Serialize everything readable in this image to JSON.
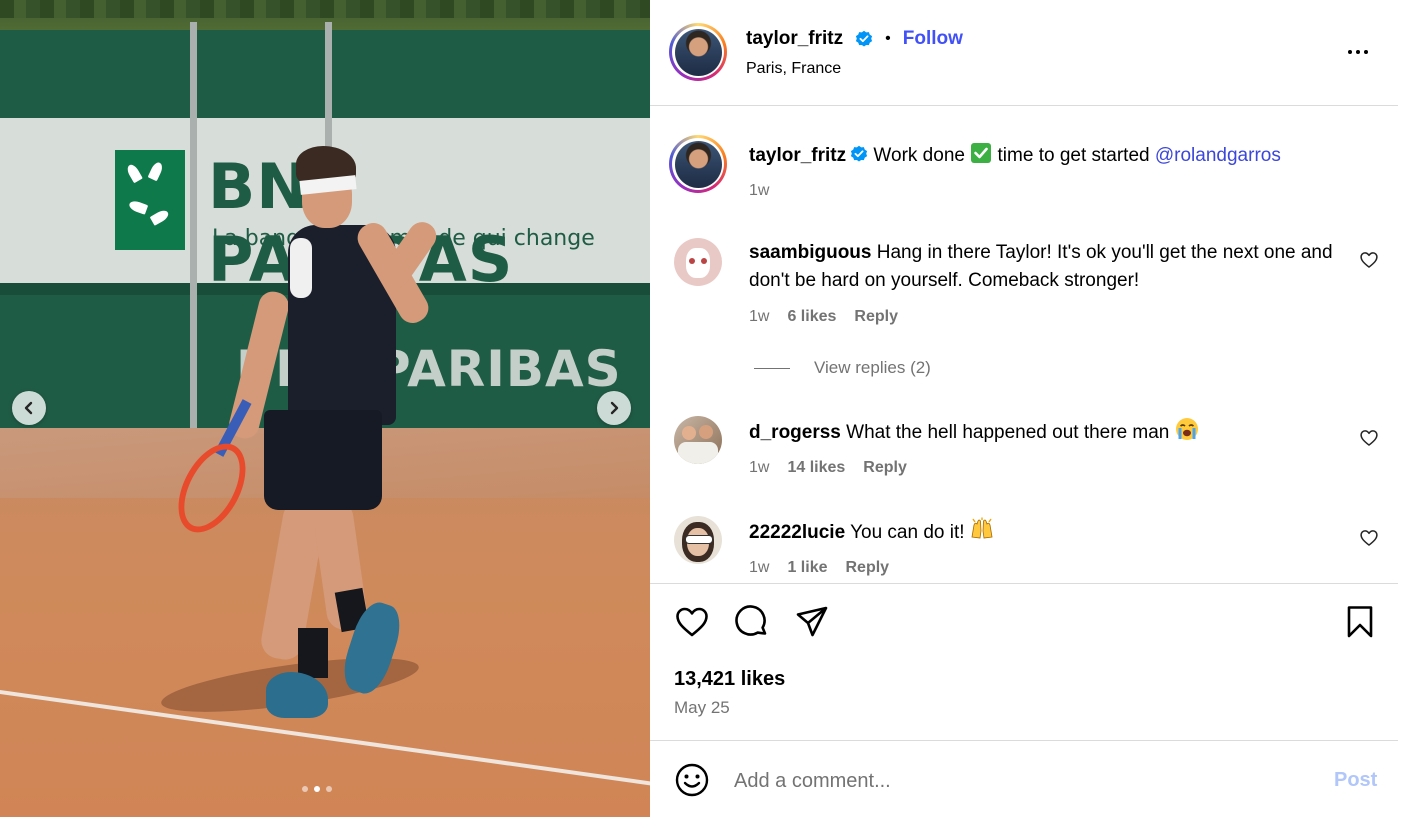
{
  "post": {
    "username": "taylor_fritz",
    "follow_label": "Follow",
    "separator": "•",
    "location": "Paris, France",
    "caption_text": "Work done",
    "caption_text_2": "time to get started",
    "caption_mention": "@rolandgarros",
    "caption_time": "1w",
    "likes": "13,421 likes",
    "date": "May 25"
  },
  "media": {
    "banner_line1": "BNP PARIBAS",
    "banner_line2": "La banque d'un monde qui change",
    "banner_line3": "BNP PARIBAS",
    "slide_count": 3,
    "active_slide": 2
  },
  "comments": [
    {
      "username": "saambiguous",
      "text": "Hang in there Taylor! It's ok you'll get the next one and don't be hard on yourself. Comeback stronger!",
      "time": "1w",
      "likes": "6 likes",
      "reply_label": "Reply",
      "view_replies": "View replies (2)"
    },
    {
      "username": "d_rogerss",
      "text": "What the hell happened out there man",
      "time": "1w",
      "likes": "14 likes",
      "reply_label": "Reply"
    },
    {
      "username": "22222lucie",
      "text": "You can do it!",
      "time": "1w",
      "likes": "1 like",
      "reply_label": "Reply"
    }
  ],
  "composer": {
    "placeholder": "Add a comment...",
    "post_label": "Post"
  },
  "colors": {
    "link": "#4150f7",
    "mention": "#3c46d9",
    "muted": "#737373",
    "post_disabled": "#b1c6f9",
    "divider": "#dbdbdb"
  },
  "icons": [
    "verified-badge-icon",
    "more-options-icon",
    "heart-icon",
    "comment-icon",
    "share-icon",
    "bookmark-icon",
    "emoji-icon",
    "chevron-left-icon",
    "chevron-right-icon"
  ]
}
